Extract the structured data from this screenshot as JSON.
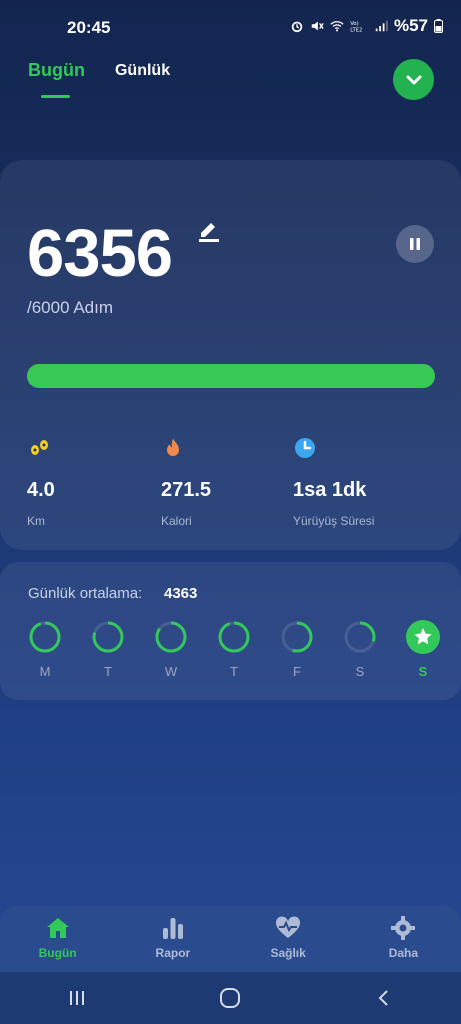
{
  "status_bar": {
    "time": "20:45",
    "icons": [
      "alarm-icon",
      "mute-icon",
      "wifi-icon",
      "volte-icon",
      "signal-icon"
    ],
    "battery": "%57"
  },
  "tabs": [
    {
      "label": "Bugün",
      "active": true
    },
    {
      "label": "Günlük",
      "active": false
    }
  ],
  "steps": {
    "count": "6356",
    "goal": "/6000 Adım",
    "progress": 1.0
  },
  "stats": [
    {
      "icon": "footprints-icon",
      "value": "4.0",
      "label": "Km",
      "color": "#f5d020"
    },
    {
      "icon": "flame-icon",
      "value": "271.5",
      "label": "Kalori",
      "color": "#f08a4b"
    },
    {
      "icon": "clock-icon",
      "value": "1sa 1dk",
      "label": "Yürüyüş Süresi",
      "color": "#3aa7f0"
    }
  ],
  "weekly": {
    "label": "Günlük ortalama:",
    "value": "4363",
    "days": [
      {
        "label": "M",
        "progress": 0.95
      },
      {
        "label": "T",
        "progress": 0.8
      },
      {
        "label": "W",
        "progress": 0.85
      },
      {
        "label": "T",
        "progress": 0.95
      },
      {
        "label": "F",
        "progress": 0.55
      },
      {
        "label": "S",
        "progress": 0.3
      },
      {
        "label": "S",
        "progress": 1.0,
        "today": true
      }
    ]
  },
  "bottom_nav": [
    {
      "label": "Bugün",
      "icon": "home-icon",
      "active": true
    },
    {
      "label": "Rapor",
      "icon": "bar-chart-icon",
      "active": false
    },
    {
      "label": "Sağlık",
      "icon": "heart-pulse-icon",
      "active": false
    },
    {
      "label": "Daha",
      "icon": "gear-icon",
      "active": false
    }
  ],
  "colors": {
    "accent": "#33c85a",
    "bg_top": "#13254f",
    "bg_bottom": "#274a96"
  }
}
